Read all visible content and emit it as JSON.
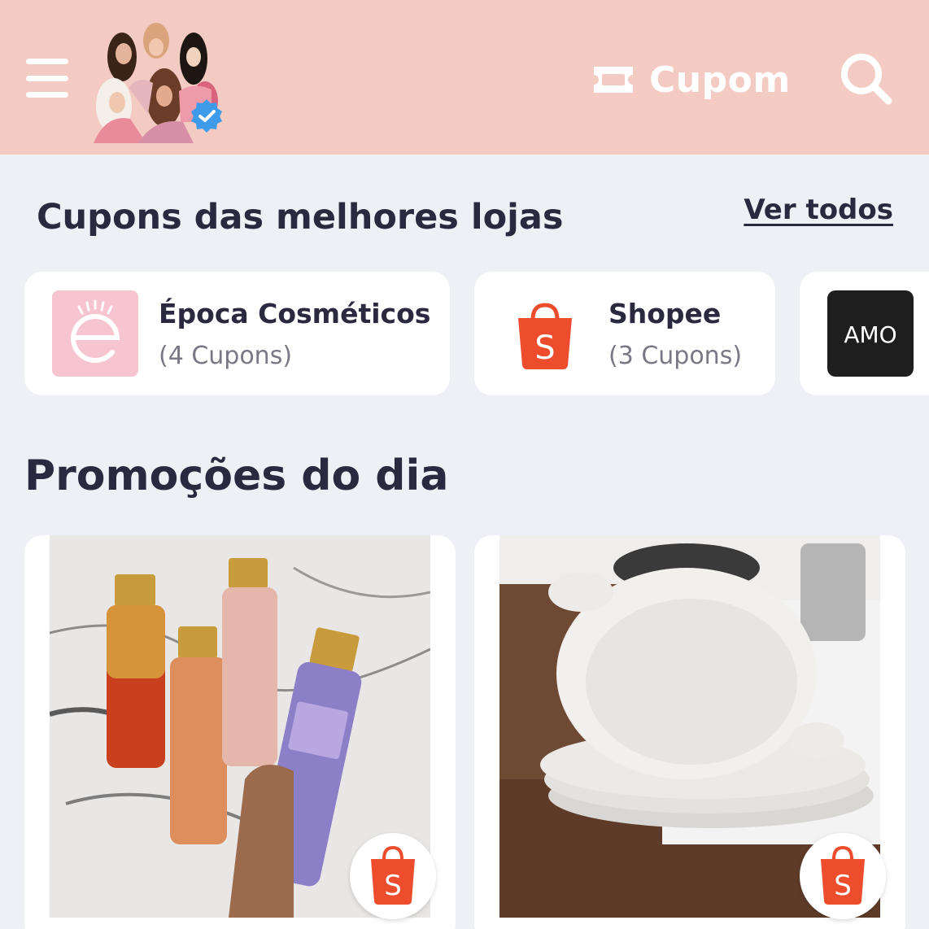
{
  "header": {
    "cupom_label": "Cupom"
  },
  "stores_section": {
    "title": "Cupons das melhores lojas",
    "see_all": "Ver todos",
    "stores": [
      {
        "name": "Época Cosméticos",
        "count": "(4 Cupons)",
        "logo_letter": "e",
        "logo_bg": "#f7c5cf"
      },
      {
        "name": "Shopee",
        "count": "(3 Cupons)",
        "logo_letter": "S",
        "logo_bg": "#ee4d2d"
      },
      {
        "name": "",
        "count": "",
        "logo_text": "AMO",
        "logo_bg": "#1e1e1e"
      }
    ]
  },
  "promos_section": {
    "title": "Promoções do dia",
    "items": [
      {
        "store_badge": "S",
        "image": "victorias-secret-body-mists"
      },
      {
        "store_badge": "S",
        "image": "white-serving-dishes"
      }
    ]
  },
  "colors": {
    "header_bg": "#f4cbc2",
    "page_bg": "#eff0f5",
    "shopee_orange": "#ee4d2d"
  }
}
